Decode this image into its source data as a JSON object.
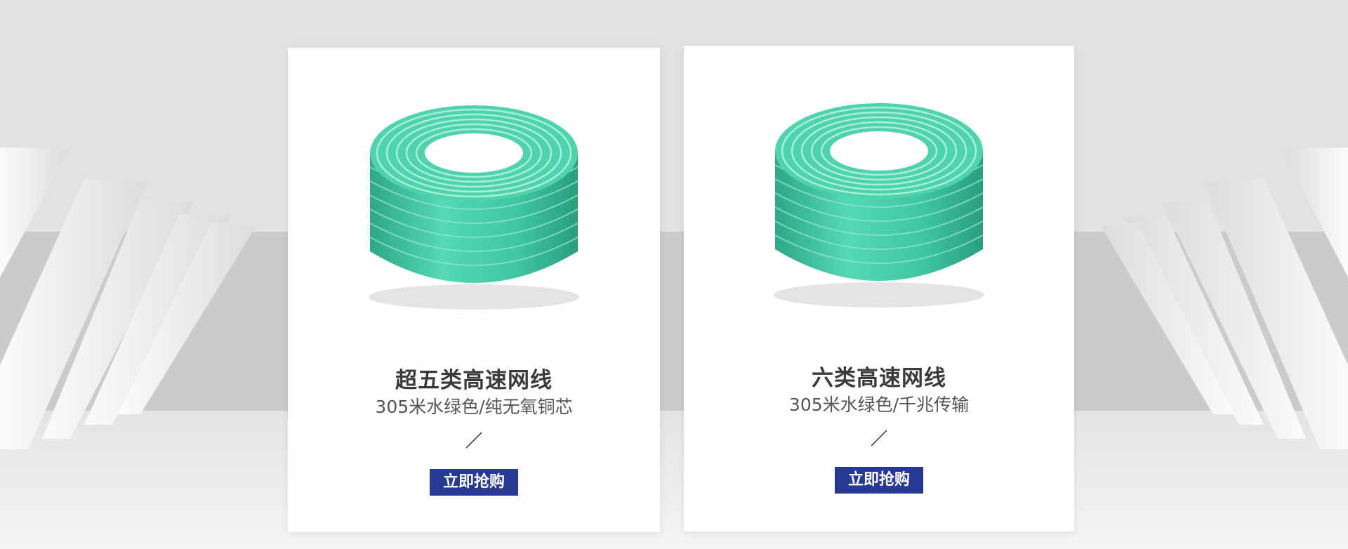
{
  "colors": {
    "button_bg": "#273a93",
    "button_text": "#ffffff",
    "title_text": "#3a3a3a",
    "subtitle_text": "#555555",
    "cable_green": "#3ec9a4"
  },
  "products": [
    {
      "title": "超五类高速网线",
      "subtitle": "305米水绿色/纯无氧铜芯",
      "button_label": "立即抢购",
      "image_icon": "cable-coil-icon"
    },
    {
      "title": "六类高速网线",
      "subtitle": "305米水绿色/千兆传输",
      "button_label": "立即抢购",
      "image_icon": "cable-coil-icon"
    }
  ]
}
